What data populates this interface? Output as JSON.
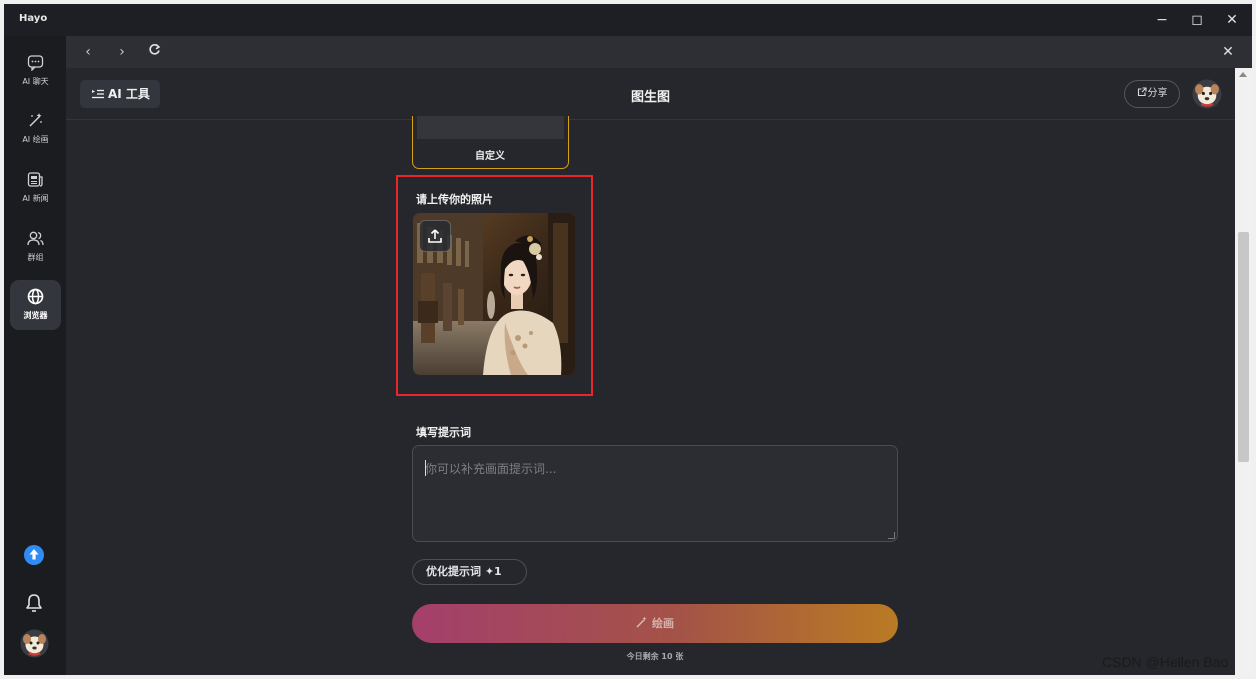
{
  "window": {
    "app_title": "Hayo",
    "controls": {
      "minimize": "−",
      "maximize": "◻",
      "close": "✕"
    }
  },
  "sidebar": {
    "items": [
      {
        "label": "AI 聊天",
        "icon": "chat-icon"
      },
      {
        "label": "AI 绘画",
        "icon": "magic-wand-icon"
      },
      {
        "label": "AI 新闻",
        "icon": "news-icon"
      },
      {
        "label": "群组",
        "icon": "group-icon"
      },
      {
        "label": "浏览器",
        "icon": "globe-icon",
        "active": true
      }
    ],
    "bottom": [
      "upload-arrow-icon",
      "bell-icon",
      "avatar"
    ]
  },
  "browser_nav": {
    "back": "‹",
    "forward": "›",
    "reload": "⟳",
    "close": "✕"
  },
  "header": {
    "tools_button": "AI 工具",
    "title": "图生图",
    "share_button": "分享"
  },
  "style_card": {
    "label": "自定义"
  },
  "upload": {
    "title": "请上传你的照片"
  },
  "prompt": {
    "title": "填写提示词",
    "placeholder": "你可以补充画面提示词..."
  },
  "optimize_button": "优化提示词 ✦1",
  "draw_button": "绘画",
  "quota_text": "今日剩余 10 张",
  "watermark": "CSDN @Hellen Bao",
  "colors": {
    "accent_border": "#d4a017",
    "highlight": "#e8262b",
    "draw_gradient_start": "#a43f6c",
    "draw_gradient_end": "#b97b23"
  }
}
